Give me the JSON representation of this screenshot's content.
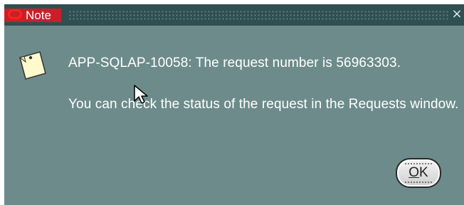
{
  "window": {
    "title": "Note",
    "close_glyph": "×",
    "background_color": "#6d8b8b",
    "titlebar_color": "#2f4f52",
    "title_accent_color": "#c8202a",
    "logo_color": "#ff2020"
  },
  "message": {
    "line1": "APP-SQLAP-10058: The request number is 56963303.",
    "line2": "You can check the status of the request in the Requests window."
  },
  "buttons": {
    "ok": {
      "mnemonic": "O",
      "rest": "K"
    }
  },
  "icons": {
    "logo": "oracle-logo-icon",
    "note": "note-icon",
    "close": "close-icon",
    "cursor": "mouse-pointer-icon"
  }
}
